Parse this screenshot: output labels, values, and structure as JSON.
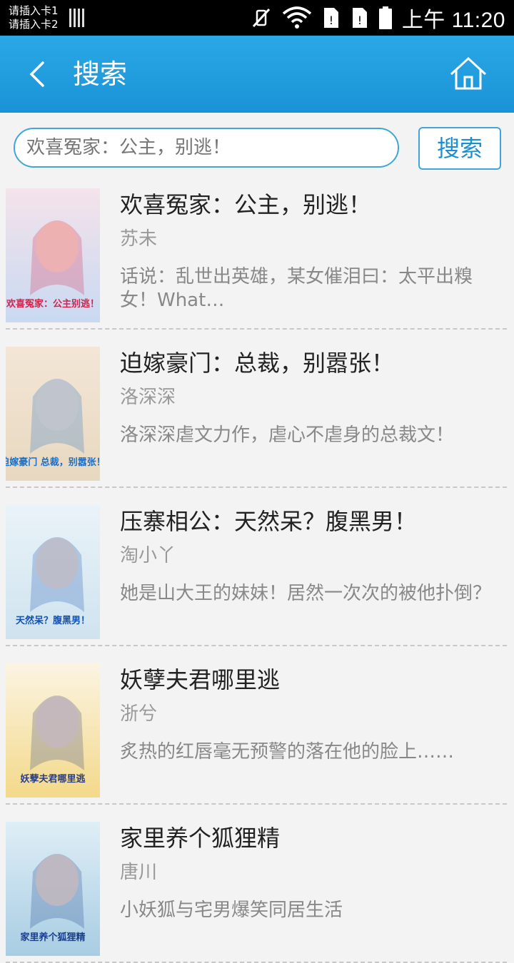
{
  "status_bar": {
    "sim1": "请插入卡1",
    "sim2": "请插入卡2",
    "time": "上午 11:20"
  },
  "header": {
    "title": "搜索",
    "back_icon": "chevron-left-icon",
    "home_icon": "home-icon"
  },
  "search": {
    "placeholder": "欢喜冤家：公主，别逃！",
    "button_label": "搜索"
  },
  "results": [
    {
      "title": "欢喜冤家：公主，别逃！",
      "author": "苏未",
      "description": "话说：乱世出英雄，某女催泪曰：太平出糗女！What…",
      "cover_text": "欢喜冤家：公主别逃！",
      "cover_colors": [
        "#f4e3ea",
        "#c9d9f2"
      ],
      "cover_accent": "#d2234b"
    },
    {
      "title": "迫嫁豪门：总裁，别嚣张！",
      "author": "洛深深",
      "description": "洛深深虐文力作，虐心不虐身的总裁文！",
      "cover_text": "迫嫁豪门 总裁，别嚣张！",
      "cover_colors": [
        "#f3e6d6",
        "#e8d8c0"
      ],
      "cover_accent": "#1d6fc4"
    },
    {
      "title": "压寨相公：天然呆？腹黑男！",
      "author": "淘小丫",
      "description": "她是山大王的妹妹！居然一次次的被他扑倒？",
      "cover_text": "天然呆？腹黑男！",
      "cover_colors": [
        "#eaf3f8",
        "#cfe3ef"
      ],
      "cover_accent": "#1453b0"
    },
    {
      "title": "妖孽夫君哪里逃",
      "author": "浙兮",
      "description": "炙热的红唇毫无预警的落在他的脸上……",
      "cover_text": "妖孽夫君哪里逃",
      "cover_colors": [
        "#fbf4e2",
        "#f3d98a"
      ],
      "cover_accent": "#2c3e80"
    },
    {
      "title": "家里养个狐狸精",
      "author": "唐川",
      "description": "小妖狐与宅男爆笑同居生活",
      "cover_text": "家里养个狐狸精",
      "cover_colors": [
        "#dfeef6",
        "#a8cde3"
      ],
      "cover_accent": "#1a3f8a"
    }
  ]
}
